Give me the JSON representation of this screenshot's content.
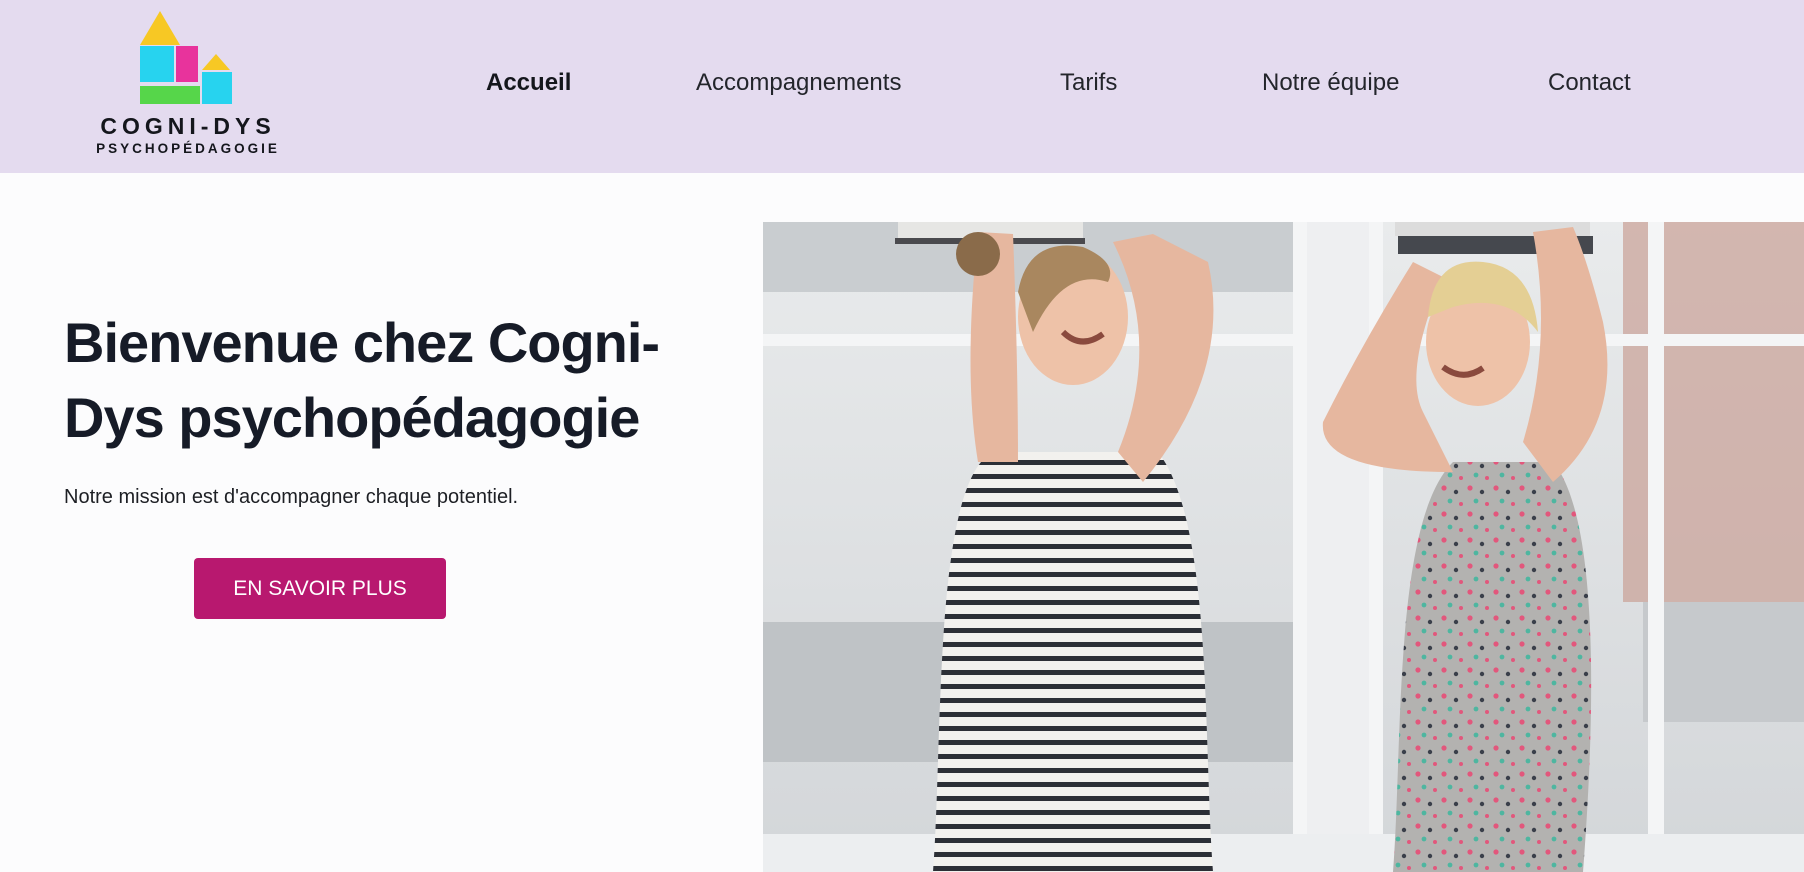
{
  "brand": {
    "name": "COGNI-DYS",
    "tagline": "PSYCHOPÉDAGOGIE",
    "colors": {
      "header_bg": "#e4dbef",
      "roof": "#f7c824",
      "block_cyan": "#27d3ef",
      "block_magenta": "#e8339c",
      "block_green": "#56d64a",
      "cta": "#b8186f"
    }
  },
  "nav": {
    "items": [
      {
        "label": "Accueil",
        "active": true
      },
      {
        "label": "Accompagnements",
        "active": false
      },
      {
        "label": "Tarifs",
        "active": false
      },
      {
        "label": "Notre équipe",
        "active": false
      },
      {
        "label": "Contact",
        "active": false
      }
    ]
  },
  "hero": {
    "title": "Bienvenue chez Cogni-Dys psychopédagogie",
    "subtitle": "Notre mission est d'accompagner chaque potentiel.",
    "cta_label": "EN SAVOIR PLUS"
  }
}
